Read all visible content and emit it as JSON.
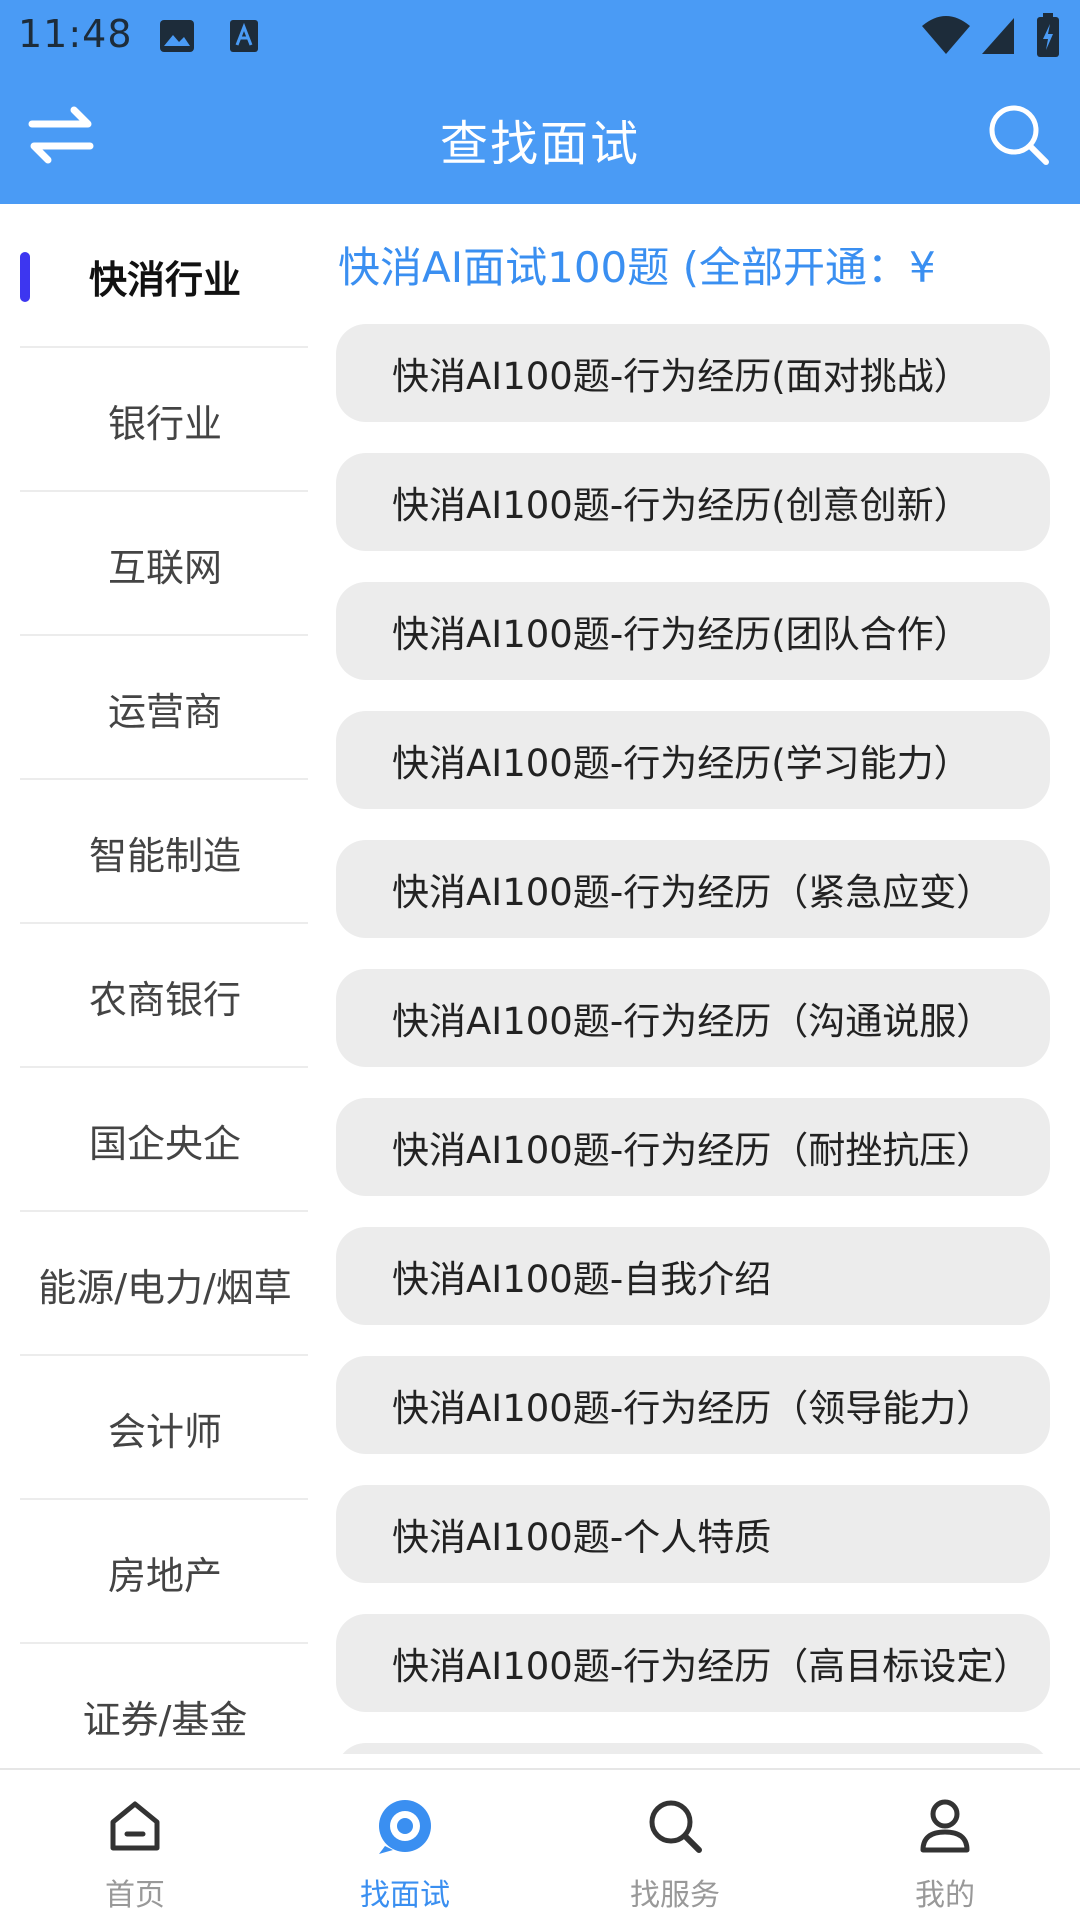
{
  "status_bar": {
    "time": "11:48",
    "icons": [
      "gallery-icon",
      "accessibility-icon",
      "wifi-icon",
      "signal-icon",
      "battery-icon"
    ]
  },
  "app_bar": {
    "title": "查找面试",
    "left_icon": "switch-arrows-icon",
    "right_icon": "search-icon"
  },
  "colors": {
    "primary": "#4a9bf5",
    "accent_text": "#3a8ff1",
    "indicator": "#3d36f0",
    "item_bg": "#ececec"
  },
  "sidebar": {
    "items": [
      {
        "label": "快消行业",
        "active": true
      },
      {
        "label": "银行业"
      },
      {
        "label": "互联网"
      },
      {
        "label": "运营商"
      },
      {
        "label": "智能制造"
      },
      {
        "label": "农商银行"
      },
      {
        "label": "国企央企"
      },
      {
        "label": "能源/电力/烟草"
      },
      {
        "label": "会计师"
      },
      {
        "label": "房地产"
      },
      {
        "label": "证券/基金"
      }
    ]
  },
  "content": {
    "heading": "快消AI面试100题 (全部开通：¥",
    "items": [
      "快消AI100题-行为经历(面对挑战）",
      "快消AI100题-行为经历(创意创新）",
      "快消AI100题-行为经历(团队合作）",
      "快消AI100题-行为经历(学习能力）",
      "快消AI100题-行为经历（紧急应变）",
      "快消AI100题-行为经历（沟通说服）",
      "快消AI100题-行为经历（耐挫抗压）",
      "快消AI100题-自我介绍",
      "快消AI100题-行为经历（领导能力）",
      "快消AI100题-个人特质",
      "快消AI100题-行为经历（高目标设定）",
      ""
    ]
  },
  "bottom_nav": {
    "items": [
      {
        "label": "首页",
        "icon": "home-icon"
      },
      {
        "label": "找面试",
        "icon": "target-icon",
        "active": true
      },
      {
        "label": "找服务",
        "icon": "search-icon"
      },
      {
        "label": "我的",
        "icon": "person-icon"
      }
    ]
  }
}
